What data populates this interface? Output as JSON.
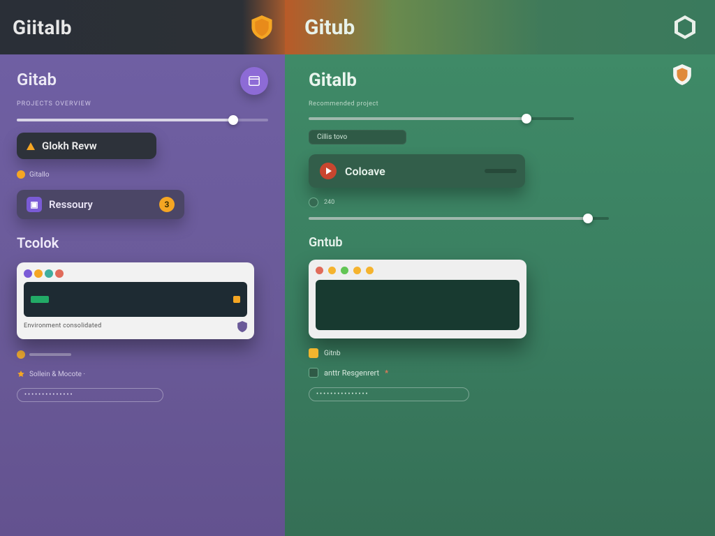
{
  "left": {
    "topbar_brand": "Giitalb",
    "sub_brand": "Gitab",
    "section_label": "PROJECTS OVERVIEW",
    "slider1_pct": 86,
    "review_btn": "Glokh Revw",
    "mini_chip1": "Gitallo",
    "repo_btn": "Ressoury",
    "repo_badge": "3",
    "section_title": "Tcolok",
    "terminal_caption": "Environment consolidated",
    "footer_text": "Sollein & Mocote  ·",
    "password_mask": "••••••••••••••"
  },
  "right": {
    "topbar_brand": "Gitub",
    "sub_brand": "Gitalb",
    "hint_label": "Recommended project",
    "slider1_pct": 82,
    "chip_label": "Cillis tovo",
    "collab_btn": "Coloave",
    "dot_label": "240",
    "slider2_pct": 93,
    "sub_brand2": "Gntub",
    "yellow_chip": "Gitnb",
    "footer_text": "anttr Resgenrert",
    "password_mask": "•••••••••••••••"
  },
  "colors": {
    "purple": "#6b5b9a",
    "green": "#3f8a67",
    "orange": "#f5a623",
    "red": "#c9462f"
  }
}
